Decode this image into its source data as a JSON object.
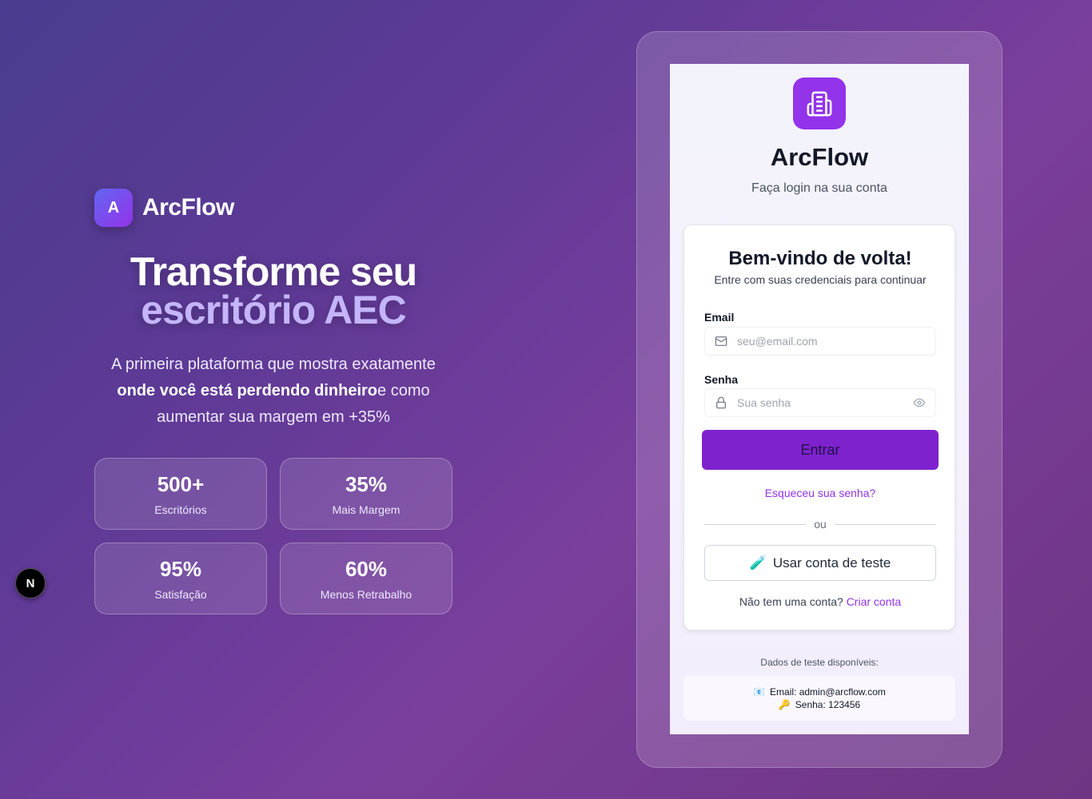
{
  "brand": {
    "logo_letter": "A",
    "name": "ArcFlow"
  },
  "hero": {
    "line1": "Transforme seu",
    "line2": "escritório AEC",
    "desc_pre": "A primeira plataforma que mostra exatamente ",
    "desc_bold": "onde você está perdendo dinheiro",
    "desc_post": "e como aumentar sua margem em +35%"
  },
  "stats": [
    {
      "value": "500+",
      "label": "Escritórios"
    },
    {
      "value": "35%",
      "label": "Mais Margem"
    },
    {
      "value": "95%",
      "label": "Satisfação"
    },
    {
      "value": "60%",
      "label": "Menos Retrabalho"
    }
  ],
  "dev_badge": "N",
  "login": {
    "app_title": "ArcFlow",
    "app_subtitle": "Faça login na sua conta",
    "card_title": "Bem-vindo de volta!",
    "card_subtitle": "Entre com suas credenciais para continuar",
    "email_label": "Email",
    "email_placeholder": "seu@email.com",
    "password_label": "Senha",
    "password_placeholder": "Sua senha",
    "submit_label": "Entrar",
    "forgot_label": "Esqueceu sua senha?",
    "divider_text": "ou",
    "test_account_icon": "🧪",
    "test_account_label": "Usar conta de teste",
    "signup_prompt": "Não tem uma conta?",
    "signup_link": "Criar conta"
  },
  "test_data": {
    "title": "Dados de teste disponíveis:",
    "email_icon": "📧",
    "email_line": "Email: admin@arcflow.com",
    "password_icon": "🔑",
    "password_line": "Senha: 123456"
  },
  "colors": {
    "primary": "#7e22ce",
    "accent": "#9333ea",
    "highlight": "#c4b5fd"
  }
}
